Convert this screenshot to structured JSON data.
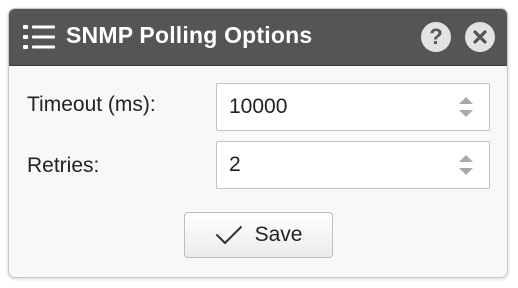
{
  "dialog": {
    "title": "SNMP Polling Options",
    "help_glyph": "?",
    "menu_icon": "list-icon",
    "help_icon": "help-icon",
    "close_icon": "close-icon"
  },
  "fields": {
    "timeout": {
      "label": "Timeout (ms):",
      "value": "10000"
    },
    "retries": {
      "label": "Retries:",
      "value": "2"
    }
  },
  "actions": {
    "save_label": "Save",
    "save_icon": "checkmark-icon"
  },
  "colors": {
    "titlebar_bg": "#555555",
    "title_text": "#ffffff",
    "header_button_bg": "#e3e3e3",
    "body_bg": "#f8f8f8"
  }
}
